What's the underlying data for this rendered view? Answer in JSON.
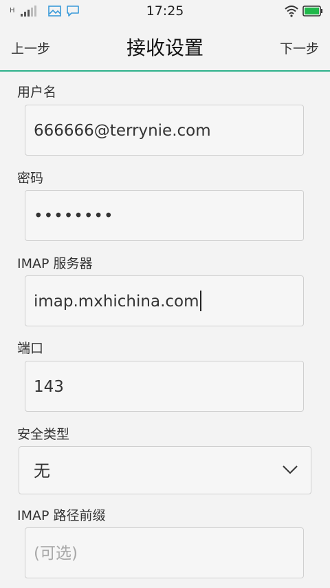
{
  "status_bar": {
    "network_type": "H",
    "time": "17:25"
  },
  "header": {
    "prev_label": "上一步",
    "title": "接收设置",
    "next_label": "下一步"
  },
  "form": {
    "username": {
      "label": "用户名",
      "value": "666666@terrynie.com"
    },
    "password": {
      "label": "密码",
      "value": "••••••••"
    },
    "imap_server": {
      "label": "IMAP 服务器",
      "value": "imap.mxhichina.com"
    },
    "port": {
      "label": "端口",
      "value": "143"
    },
    "security_type": {
      "label": "安全类型",
      "value": "无"
    },
    "imap_path_prefix": {
      "label": "IMAP 路径前缀",
      "value": "",
      "placeholder": "(可选)"
    }
  },
  "colors": {
    "accent": "#2cb08a",
    "battery": "#1fb84a",
    "notification_icons": "#3a9ad9"
  }
}
